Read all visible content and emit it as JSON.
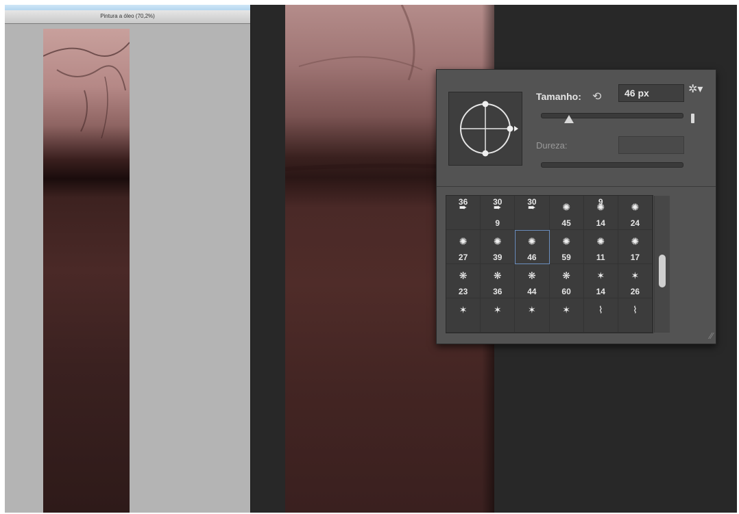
{
  "window": {
    "title": "Pintura a óleo (70,2%)"
  },
  "brush_panel": {
    "size_label": "Tamanho:",
    "size_value": "46 px",
    "size_slider_percent": 20,
    "hardness_label": "Dureza:",
    "reset_icon": "reset-arrow-icon",
    "gear_icon": "gear-icon",
    "selected_brush": 46,
    "rows": [
      {
        "cells": [
          {
            "top": "36",
            "tip": "pencil",
            "bottom": ""
          },
          {
            "top": "30",
            "tip": "pencil",
            "bottom": "9"
          },
          {
            "top": "30",
            "tip": "pencil",
            "bottom": ""
          },
          {
            "top": "",
            "tip": "splatter",
            "bottom": "45"
          },
          {
            "top": "9",
            "tip": "splatter",
            "bottom": "14"
          },
          {
            "top": "",
            "tip": "splatter",
            "bottom": "24"
          }
        ]
      },
      {
        "cells": [
          {
            "top": "",
            "tip": "splatter",
            "bottom": "27"
          },
          {
            "top": "",
            "tip": "splatter",
            "bottom": "39"
          },
          {
            "top": "",
            "tip": "splatter",
            "bottom": "46"
          },
          {
            "top": "",
            "tip": "splatter",
            "bottom": "59"
          },
          {
            "top": "",
            "tip": "splatter",
            "bottom": "11"
          },
          {
            "top": "",
            "tip": "splatter",
            "bottom": "17"
          }
        ]
      },
      {
        "cells": [
          {
            "top": "",
            "tip": "chalk",
            "bottom": "23"
          },
          {
            "top": "",
            "tip": "chalk",
            "bottom": "36"
          },
          {
            "top": "",
            "tip": "chalk",
            "bottom": "44"
          },
          {
            "top": "",
            "tip": "chalk",
            "bottom": "60"
          },
          {
            "top": "",
            "tip": "star",
            "bottom": "14"
          },
          {
            "top": "",
            "tip": "star",
            "bottom": "26"
          }
        ]
      },
      {
        "cells": [
          {
            "top": "",
            "tip": "star",
            "bottom": ""
          },
          {
            "top": "",
            "tip": "star",
            "bottom": ""
          },
          {
            "top": "",
            "tip": "star",
            "bottom": ""
          },
          {
            "top": "",
            "tip": "star",
            "bottom": ""
          },
          {
            "top": "",
            "tip": "grass",
            "bottom": ""
          },
          {
            "top": "",
            "tip": "grass",
            "bottom": ""
          }
        ]
      }
    ]
  },
  "colors": {
    "panel_bg": "#535353",
    "workspace_bg": "#282828",
    "selection_outline": "#6c8fc0"
  }
}
